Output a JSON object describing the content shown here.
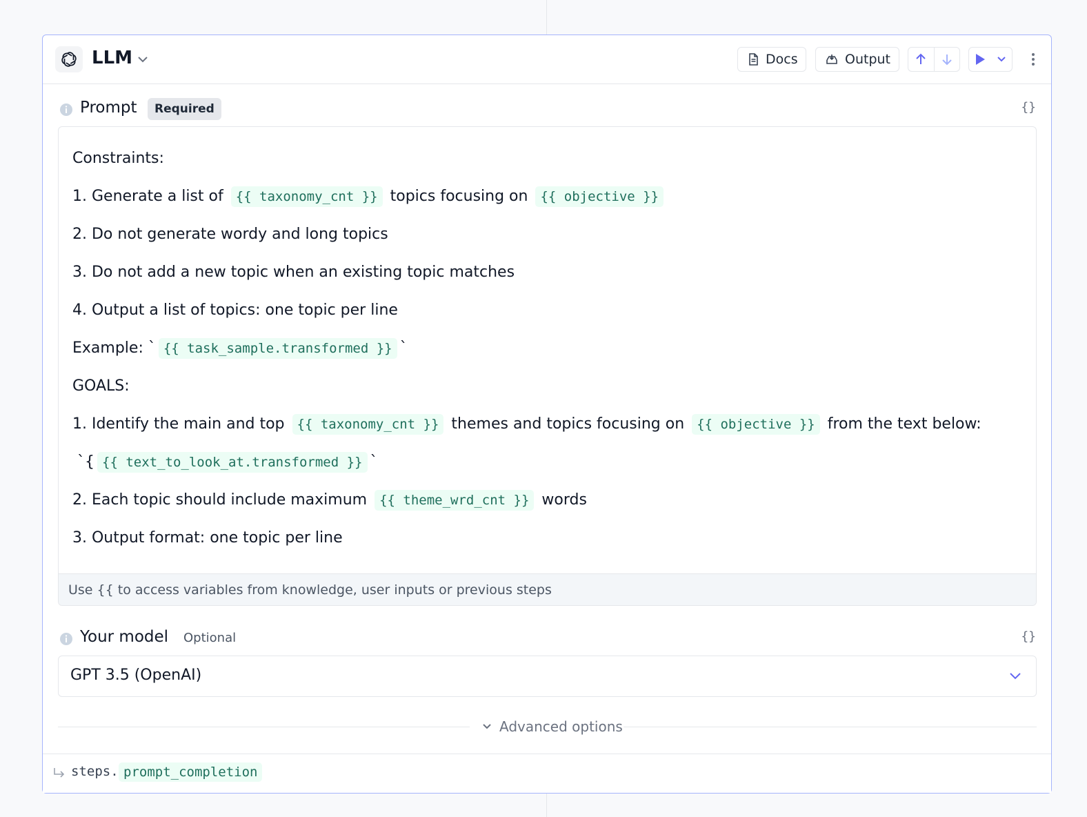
{
  "step": {
    "title": "LLM",
    "icon": "openai-logo-icon"
  },
  "toolbar": {
    "docs_label": "Docs",
    "output_label": "Output",
    "accent_color": "#6366f1"
  },
  "prompt": {
    "label": "Prompt",
    "badge": "Required",
    "braces": "{}",
    "lines": [
      [
        {
          "t": "Constraints:"
        }
      ],
      [
        {
          "t": "1. Generate a list of "
        },
        {
          "v": "{{ taxonomy_cnt }}"
        },
        {
          "t": " topics focusing on "
        },
        {
          "v": "{{ objective }}"
        }
      ],
      [
        {
          "t": "2. Do not generate wordy and long topics"
        }
      ],
      [
        {
          "t": "3. Do not add a new topic when an existing topic matches"
        }
      ],
      [
        {
          "t": "4. Output a list of topics: one topic per line"
        }
      ],
      [
        {
          "t": "Example: `"
        },
        {
          "v": "{{ task_sample.transformed }}"
        },
        {
          "t": "`"
        }
      ],
      [
        {
          "t": "GOALS:"
        }
      ],
      [
        {
          "t": "1. Identify the main and top "
        },
        {
          "v": "{{ taxonomy_cnt }}"
        },
        {
          "t": " themes and topics focusing on "
        },
        {
          "v": "{{ objective }}"
        },
        {
          "t": " from the text below:"
        }
      ],
      [
        {
          "t": " `{"
        },
        {
          "v": "{{ text_to_look_at.transformed }}"
        },
        {
          "t": "`"
        }
      ],
      [
        {
          "t": "2. Each topic should include maximum "
        },
        {
          "v": "{{ theme_wrd_cnt }}"
        },
        {
          "t": " words"
        }
      ],
      [
        {
          "t": "3. Output format: one topic per line"
        }
      ]
    ],
    "footer_hint": "Use {{ to access variables from knowledge, user inputs or previous steps"
  },
  "model": {
    "label": "Your model",
    "badge": "Optional",
    "braces": "{}",
    "selected": "GPT 3.5 (OpenAI)"
  },
  "advanced": {
    "label": "Advanced options"
  },
  "output": {
    "prefix": "steps.",
    "variable": "prompt_completion"
  }
}
